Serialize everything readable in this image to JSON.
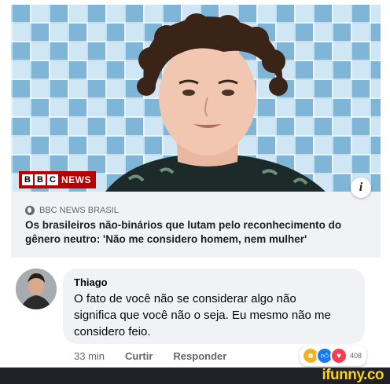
{
  "post": {
    "image_alt_subject": "portrait photo",
    "brand": {
      "box_letters": [
        "B",
        "B",
        "C"
      ],
      "news_label": "NEWS",
      "color": "#b80000"
    },
    "info_icon": "info-icon",
    "source": "BBC NEWS BRASIL",
    "headline": "Os brasileiros não-binários que lutam pelo reconhecimento do gênero neutro: 'Não me considero homem, nem mulher'"
  },
  "comment": {
    "author": "Thiago",
    "text": "O fato de você não se considerar algo não significa que você não o seja. Eu mesmo não me considero feio.",
    "time": "33 min",
    "curtir_label": "Curtir",
    "reply_label": "Responder",
    "reactions": {
      "icons": [
        "haha-icon",
        "like-icon",
        "love-icon"
      ],
      "count": "408"
    }
  },
  "watermark": "ifunny.co",
  "colors": {
    "bubble": "#f0f2f5",
    "accent_like": "#1877f2",
    "watermark": "#f7d21b"
  }
}
